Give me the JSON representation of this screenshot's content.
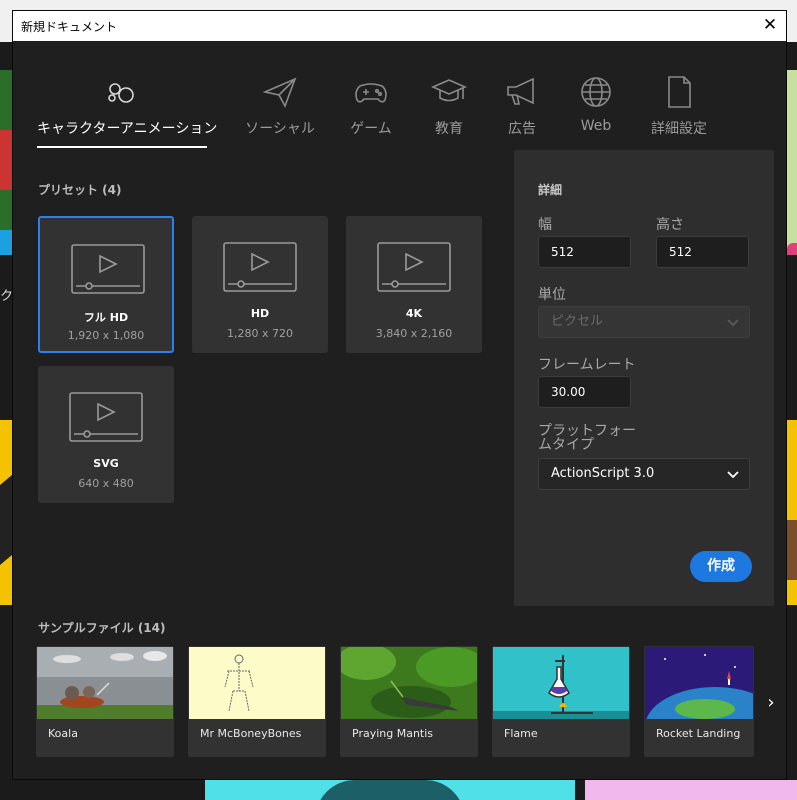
{
  "dialog": {
    "title": "新規ドキュメント"
  },
  "tabs": [
    {
      "label": "キャラクターアニメーション",
      "icon": "character-animation-icon",
      "active": true
    },
    {
      "label": "ソーシャル",
      "icon": "paper-plane-icon"
    },
    {
      "label": "ゲーム",
      "icon": "gamepad-icon"
    },
    {
      "label": "教育",
      "icon": "graduation-cap-icon"
    },
    {
      "label": "広告",
      "icon": "megaphone-icon"
    },
    {
      "label": "Web",
      "icon": "globe-icon"
    },
    {
      "label": "詳細設定",
      "icon": "document-icon"
    }
  ],
  "presets": {
    "label": "プリセット (4)",
    "items": [
      {
        "name": "フル HD",
        "size": "1,920 x 1,080",
        "selected": true
      },
      {
        "name": "HD",
        "size": "1,280 x 720"
      },
      {
        "name": "4K",
        "size": "3,840 x 2,160"
      },
      {
        "name": "SVG",
        "size": "640 x 480"
      }
    ]
  },
  "details": {
    "label": "詳細",
    "width_label": "幅",
    "width_value": "512",
    "height_label": "高さ",
    "height_value": "512",
    "unit_label": "単位",
    "unit_value": "ピクセル",
    "framerate_label": "フレームレート",
    "framerate_value": "30.00",
    "platform_label_line1": "プラットフォー",
    "platform_label_line2": "ムタイプ",
    "platform_value": "ActionScript 3.0",
    "create_label": "作成"
  },
  "samples": {
    "label": "サンプルファイル (14)",
    "items": [
      {
        "name": "Koala"
      },
      {
        "name": "Mr McBoneyBones"
      },
      {
        "name": "Praying Mantis"
      },
      {
        "name": "Flame"
      },
      {
        "name": "Rocket Landing"
      }
    ]
  },
  "colors": {
    "accent": "#1d78e0",
    "selected_border": "#2d7ff0",
    "panel": "#2e2e2e",
    "dialog_bg": "#1f1f1f"
  },
  "background": {
    "left_text": "ク"
  }
}
